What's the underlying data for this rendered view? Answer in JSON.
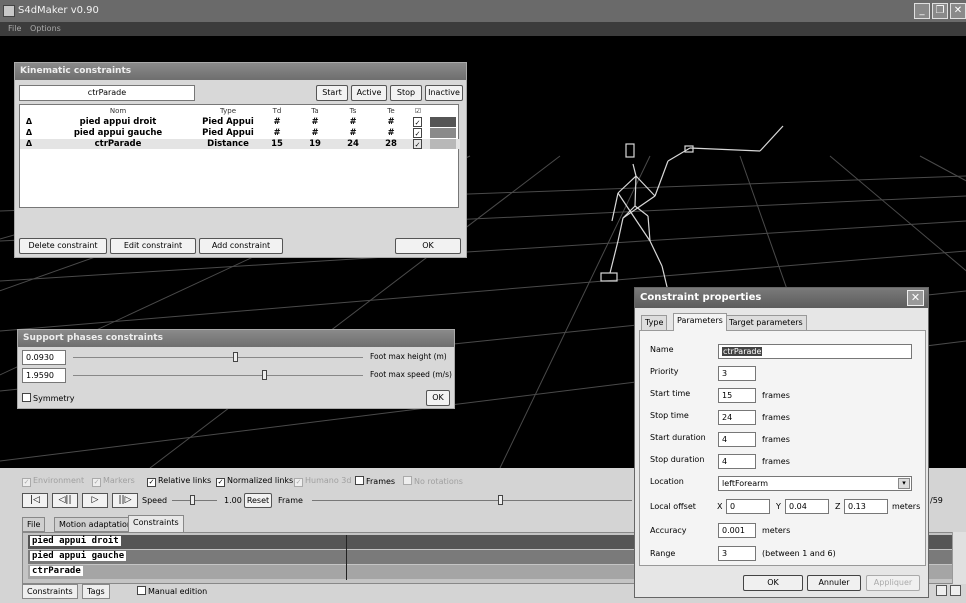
{
  "app": {
    "title": "S4dMaker v0.90",
    "menu": [
      "File",
      "Options"
    ]
  },
  "window_buttons": {
    "minimize": "_",
    "restore": "❐",
    "close": "✕"
  },
  "kinematic": {
    "title": "Kinematic constraints",
    "name_field": "ctrParade",
    "state_buttons": [
      "Start",
      "Active",
      "Stop",
      "Inactive"
    ],
    "columns": [
      "Nom",
      "Type",
      "Td",
      "Ta",
      "Ts",
      "Te",
      "☑"
    ],
    "rows": [
      {
        "nom": "pied appui droit",
        "type": "Pied Appui",
        "td": "#",
        "ta": "#",
        "ts": "#",
        "te": "#",
        "checked": "✓",
        "color": "#555555"
      },
      {
        "nom": "pied appui gauche",
        "type": "Pied Appui",
        "td": "#",
        "ta": "#",
        "ts": "#",
        "te": "#",
        "checked": "✓",
        "color": "#8a8a8a"
      },
      {
        "nom": "ctrParade",
        "type": "Distance",
        "td": "15",
        "ta": "19",
        "ts": "24",
        "te": "28",
        "checked": "✓",
        "color": "#b8b8b8"
      }
    ],
    "buttons": {
      "delete": "Delete constraint",
      "edit": "Edit constraint",
      "add": "Add constraint",
      "ok": "OK"
    }
  },
  "support": {
    "title": "Support phases constraints",
    "height_value": "0.0930",
    "height_label": "Foot max height (m)",
    "height_level": 0.55,
    "speed_value": "1.9590",
    "speed_label": "Foot max speed (m/s)",
    "speed_level": 0.65,
    "symmetry": "Symmetry",
    "ok": "OK"
  },
  "options": {
    "environment": "Environment",
    "markers": "Markers",
    "relative_links": "Relative links",
    "normalized_links": "Normalized links",
    "humano3d": "Humano 3d",
    "frames": "Frames",
    "no_rotations": "No rotations"
  },
  "playback": {
    "first": "|◁",
    "prev": "◁||",
    "play": "▷",
    "next": "||▷",
    "speed_label": "Speed",
    "speed_value": "1.00",
    "speed_level": 0.4,
    "reset": "Reset",
    "frame_label": "Frame",
    "frame_level": 0.58,
    "frame_count": "/59"
  },
  "tabs": [
    "File",
    "Motion adaptation",
    "Constraints"
  ],
  "timeline": [
    "pied appui droit",
    "pied appui gauche",
    "ctrParade"
  ],
  "footer": {
    "constraints": "Constraints",
    "tags": "Tags",
    "manual": "Manual edition"
  },
  "props": {
    "title": "Constraint properties",
    "close": "✕",
    "tabs": [
      "Type",
      "Parameters",
      "Target parameters"
    ],
    "name_label": "Name",
    "name_value": "ctrParade",
    "priority_label": "Priority",
    "priority_value": "3",
    "start_time_label": "Start time",
    "start_time_value": "15",
    "stop_time_label": "Stop time",
    "stop_time_value": "24",
    "start_duration_label": "Start duration",
    "start_duration_value": "4",
    "stop_duration_label": "Stop duration",
    "stop_duration_value": "4",
    "frames_unit": "frames",
    "location_label": "Location",
    "location_value": "leftForearm",
    "offset_label": "Local offset",
    "x_label": "X",
    "x_value": "0",
    "y_label": "Y",
    "y_value": "0.04",
    "z_label": "Z",
    "z_value": "0.13",
    "meters_unit": "meters",
    "accuracy_label": "Accuracy",
    "accuracy_value": "0.001",
    "range_label": "Range",
    "range_value": "3",
    "range_unit": "(between 1 and 6)",
    "ok": "OK",
    "cancel": "Annuler",
    "apply": "Appliquer"
  }
}
